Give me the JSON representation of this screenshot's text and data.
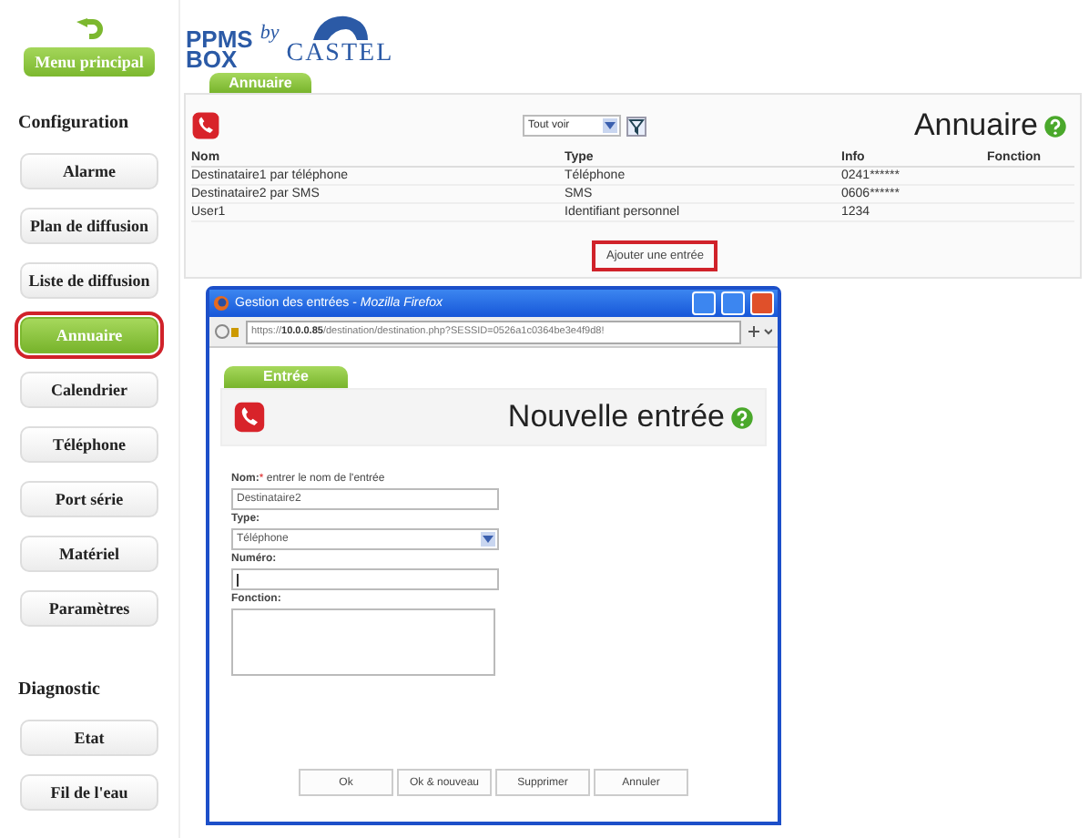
{
  "sidebar": {
    "home_button": "Menu principal",
    "sections": [
      {
        "heading": "Configuration",
        "items": [
          {
            "label": "Alarme",
            "selected": false,
            "highlighted": false
          },
          {
            "label": "Plan de diffusion",
            "selected": false,
            "highlighted": false
          },
          {
            "label": "Liste de diffusion",
            "selected": false,
            "highlighted": false
          },
          {
            "label": "Annuaire",
            "selected": true,
            "highlighted": true
          },
          {
            "label": "Calendrier",
            "selected": false,
            "highlighted": false
          },
          {
            "label": "Téléphone",
            "selected": false,
            "highlighted": false
          },
          {
            "label": "Port série",
            "selected": false,
            "highlighted": false
          },
          {
            "label": "Matériel",
            "selected": false,
            "highlighted": false
          },
          {
            "label": "Paramètres",
            "selected": false,
            "highlighted": false
          }
        ]
      },
      {
        "heading": "Diagnostic",
        "items": [
          {
            "label": "Etat",
            "selected": false,
            "highlighted": false
          },
          {
            "label": "Fil de l'eau",
            "selected": false,
            "highlighted": false
          }
        ]
      }
    ]
  },
  "logo": {
    "line1": "PPMS",
    "line2": "BOX",
    "by": "by",
    "brand": "CASTEL"
  },
  "tab": {
    "label": "Annuaire"
  },
  "panel": {
    "filter": "Tout voir",
    "title": "Annuaire",
    "table": {
      "columns": [
        "Nom",
        "Type",
        "Info",
        "Fonction"
      ],
      "rows": [
        [
          "Destinataire1 par téléphone",
          "Téléphone",
          "0241******"
        ],
        [
          "Destinataire2 par SMS",
          "SMS",
          "0606******"
        ],
        [
          "User1",
          "Identifiant personnel",
          "1234"
        ]
      ]
    },
    "add_button": {
      "label": "Ajouter une entrée",
      "highlighted": true
    }
  },
  "dialog": {
    "title": "Gestion des entrées - ",
    "app": "Mozilla Firefox",
    "url_host": "https://",
    "url_bold": "10.0.0.85",
    "url_rest": "/destination/destination.php?SESSID=0526a1c0364be3e4f9d8!",
    "tab": "Entrée",
    "heading": "Nouvelle entrée",
    "fields": [
      {
        "kind": "text",
        "label": "Nom:",
        "required": "*",
        "hint": "entrer le nom de l'entrée",
        "value": "Destinataire2"
      },
      {
        "kind": "select",
        "label": "Type:",
        "value": "Téléphone"
      },
      {
        "kind": "text",
        "label": "Numéro:"
      },
      {
        "kind": "textarea",
        "label": "Fonction:"
      }
    ],
    "buttons": [
      "Ok",
      "Ok & nouveau",
      "Supprimer",
      "Annuler"
    ]
  }
}
